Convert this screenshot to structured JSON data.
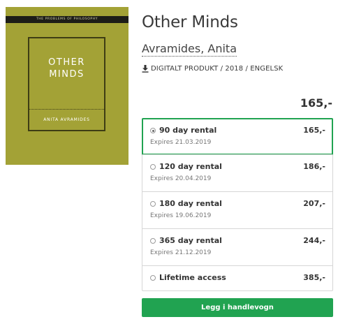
{
  "cover": {
    "series": "THE PROBLEMS OF PHILOSOPHY",
    "title": "OTHER\nMINDS",
    "author": "ANITA AVRAMIDES",
    "color": "#a3a236"
  },
  "product": {
    "title": "Other Minds",
    "author": "Avramides, Anita",
    "meta": "DIGITALT PRODUKT / 2018 / ENGELSK",
    "meta_icon": "download-icon",
    "price": "165,-"
  },
  "options": [
    {
      "label": "90 day rental",
      "price": "165,-",
      "expiry": "Expires 21.03.2019",
      "selected": true
    },
    {
      "label": "120 day rental",
      "price": "186,-",
      "expiry": "Expires 20.04.2019",
      "selected": false
    },
    {
      "label": "180 day rental",
      "price": "207,-",
      "expiry": "Expires 19.06.2019",
      "selected": false
    },
    {
      "label": "365 day rental",
      "price": "244,-",
      "expiry": "Expires 21.12.2019",
      "selected": false
    },
    {
      "label": "Lifetime access",
      "price": "385,-",
      "selected": false
    }
  ],
  "cart_button": {
    "label": "Legg i handlevogn"
  },
  "colors": {
    "accent": "#21a351",
    "border": "#d6d6d6"
  }
}
